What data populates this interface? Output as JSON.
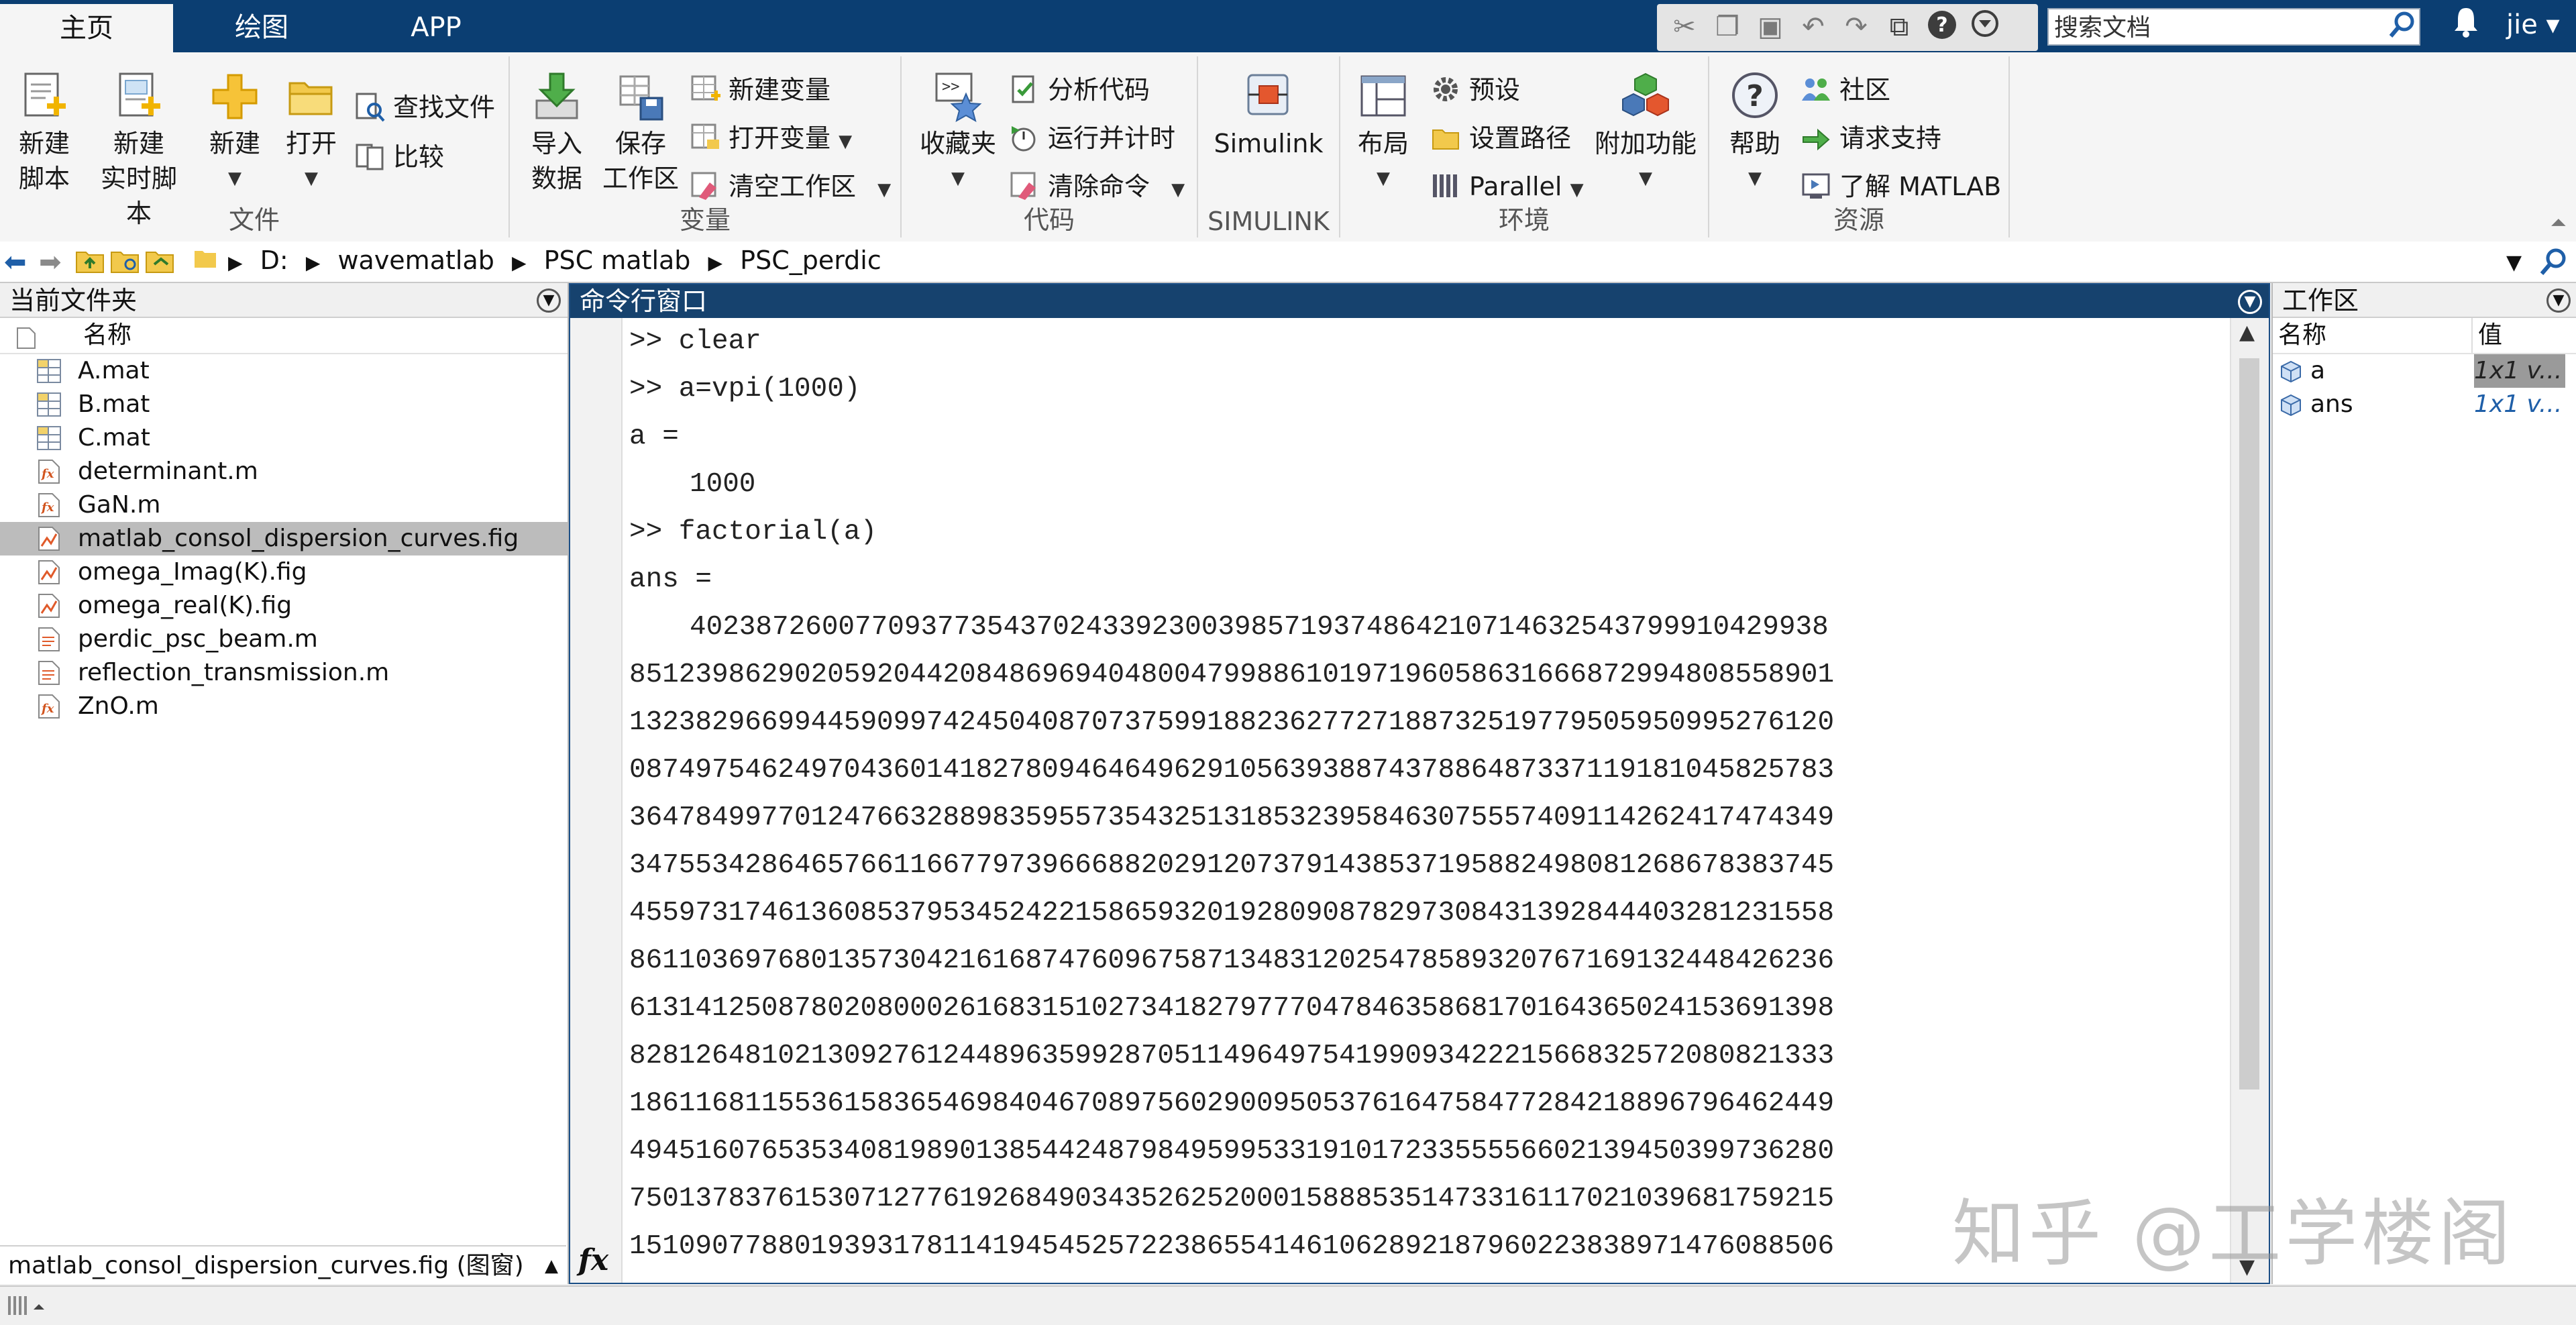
{
  "tabs": [
    {
      "label": "主页",
      "active": true
    },
    {
      "label": "绘图",
      "active": false
    },
    {
      "label": "APP",
      "active": false
    }
  ],
  "search": {
    "placeholder": "搜索文档"
  },
  "user": {
    "name": "jie ▾"
  },
  "ribbon": {
    "file_group": {
      "label": "文件",
      "new_script": "新建\n脚本",
      "new_live_script": "新建\n实时脚本",
      "new": "新建",
      "open": "打开",
      "find_files": "查找文件",
      "compare": "比较"
    },
    "variable_group": {
      "label": "变量",
      "import_data": "导入\n数据",
      "save_workspace": "保存\n工作区",
      "new_variable": "新建变量",
      "open_variable": "打开变量",
      "clear_workspace": "清空工作区"
    },
    "code_group": {
      "label": "代码",
      "favorites": "收藏夹",
      "analyze_code": "分析代码",
      "run_and_time": "运行并计时",
      "clear_commands": "清除命令"
    },
    "simulink_group": {
      "label": "SIMULINK",
      "simulink": "Simulink"
    },
    "environment_group": {
      "label": "环境",
      "layout": "布局",
      "preferences": "预设",
      "set_path": "设置路径",
      "parallel": "Parallel",
      "add_ons": "附加功能"
    },
    "resources_group": {
      "label": "资源",
      "help": "帮助",
      "community": "社区",
      "request_support": "请求支持",
      "learn_matlab": "了解 MATLAB"
    }
  },
  "address": {
    "path": [
      "D:",
      "wavematlab",
      "PSC matlab",
      "PSC_perdic"
    ]
  },
  "current_folder": {
    "title": "当前文件夹",
    "column_name": "名称",
    "files": [
      {
        "name": "A.mat",
        "type": "mat",
        "selected": false
      },
      {
        "name": "B.mat",
        "type": "mat",
        "selected": false
      },
      {
        "name": "C.mat",
        "type": "mat",
        "selected": false
      },
      {
        "name": "determinant.m",
        "type": "func",
        "selected": false
      },
      {
        "name": "GaN.m",
        "type": "func",
        "selected": false
      },
      {
        "name": "matlab_consol_dispersion_curves.fig",
        "type": "fig",
        "selected": true
      },
      {
        "name": "omega_Imag(K).fig",
        "type": "fig",
        "selected": false
      },
      {
        "name": "omega_real(K).fig",
        "type": "fig",
        "selected": false
      },
      {
        "name": "perdic_psc_beam.m",
        "type": "script",
        "selected": false
      },
      {
        "name": "reflection_transmission.m",
        "type": "script",
        "selected": false
      },
      {
        "name": "ZnO.m",
        "type": "func",
        "selected": false
      }
    ],
    "detail": "matlab_consol_dispersion_curves.fig  (图窗)"
  },
  "command_window": {
    "title": "命令行窗口",
    "lines": [
      {
        "text": ">> clear",
        "indent": false
      },
      {
        "text": ">> a=vpi(1000)",
        "indent": false
      },
      {
        "text": "a =",
        "indent": false
      },
      {
        "text": "1000",
        "indent": true
      },
      {
        "text": ">> factorial(a)",
        "indent": false
      },
      {
        "text": "ans =",
        "indent": false
      },
      {
        "text": "402387260077093773543702433923003985719374864210714632543799910429938",
        "indent": true
      },
      {
        "text": "8512398629020592044208486969404800479988610197196058631666872994808558901",
        "indent": false
      },
      {
        "text": "1323829669944590997424504087073759918823627727188732519779505950995276120",
        "indent": false
      },
      {
        "text": "0874975462497043601418278094646496291056393887437886487337119181045825783",
        "indent": false
      },
      {
        "text": "3647849977012476632889835955735432513185323958463075557409114262417474349",
        "indent": false
      },
      {
        "text": "3475534286465766116677973966688202912073791438537195882498081268678383745",
        "indent": false
      },
      {
        "text": "4559731746136085379534524221586593201928090878297308431392844403281231558",
        "indent": false
      },
      {
        "text": "8611036976801357304216168747609675871348312025478589320767169132448426236",
        "indent": false
      },
      {
        "text": "6131412508780208000261683151027341827977704784635868170164365024153691398",
        "indent": false
      },
      {
        "text": "8281264810213092761244896359928705114964975419909342221566832572080821333",
        "indent": false
      },
      {
        "text": "1861168115536158365469840467089756029009505376164758477284218896796462449",
        "indent": false
      },
      {
        "text": "4945160765353408198901385442487984959953319101723355556602139450399736280",
        "indent": false
      },
      {
        "text": "7501378376153071277619268490343526252000158885351473316117021039681759215",
        "indent": false
      },
      {
        "text": "1510907788019393178114194545257223865541461062892187960223838971476088506",
        "indent": false
      }
    ],
    "prompt_icon": "fx"
  },
  "workspace": {
    "title": "工作区",
    "col_name": "名称",
    "col_value": "值",
    "vars": [
      {
        "name": "a",
        "value": "1x1 v...",
        "selected": true
      },
      {
        "name": "ans",
        "value": "1x1 v...",
        "selected": false
      }
    ]
  },
  "watermark": "知乎 @工学楼阁",
  "colors": {
    "title_bar": "#0b3e72",
    "cmd_header": "#16426e",
    "accent": "#1f5fa8"
  }
}
